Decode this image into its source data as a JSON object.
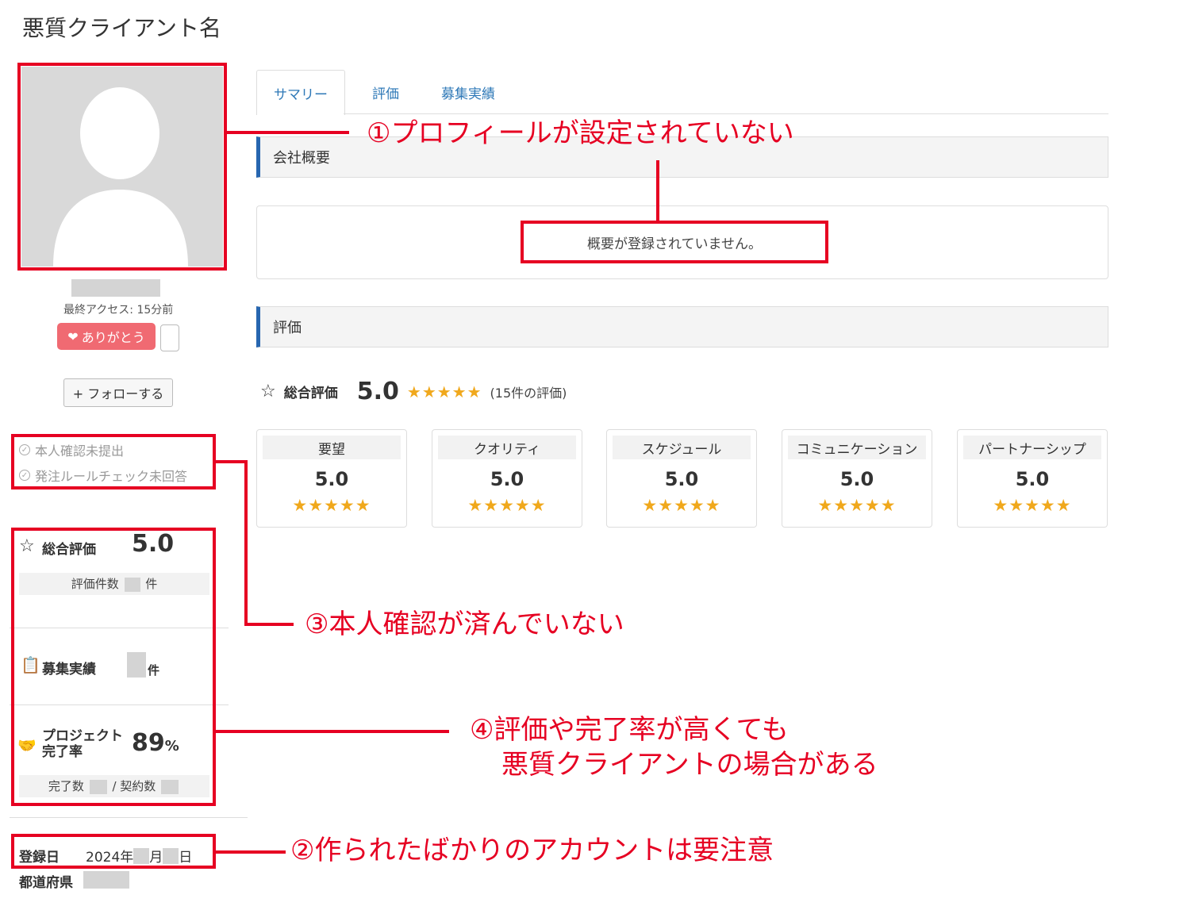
{
  "page": {
    "title": "悪質クライアント名"
  },
  "profile": {
    "last_access": "最終アクセス: 15分前",
    "thanks_label": "ありがとう",
    "follow_label": "+ フォローする",
    "checks": [
      "本人確認未提出",
      "発注ルールチェック未回答"
    ]
  },
  "side_stats": {
    "rating_label": "総合評価",
    "rating_value": "5.0",
    "review_count_prefix": "評価件数",
    "review_count_suffix": "件",
    "recruit_label": "募集実績",
    "recruit_suffix": "件",
    "project_label_line1": "プロジェクト",
    "project_label_line2": "完了率",
    "project_rate": "89",
    "project_rate_unit": "%",
    "completed_prefix": "完了数",
    "contracted_prefix": "/ 契約数",
    "registered_label": "登録日",
    "registered_year": "2024年",
    "registered_month": "月",
    "registered_day": "日",
    "prefecture_label": "都道府県"
  },
  "tabs": [
    "サマリー",
    "評価",
    "募集実績"
  ],
  "sections": {
    "company_title": "会社概要",
    "company_empty": "概要が登録されていません。",
    "rating_title": "評価"
  },
  "overall": {
    "label": "総合評価",
    "value": "5.0",
    "stars": "★★★★★",
    "count": "(15件の評価)"
  },
  "categories": [
    {
      "name": "要望",
      "score": "5.0",
      "stars": "★★★★★"
    },
    {
      "name": "クオリティ",
      "score": "5.0",
      "stars": "★★★★★"
    },
    {
      "name": "スケジュール",
      "score": "5.0",
      "stars": "★★★★★"
    },
    {
      "name": "コミュニケーション",
      "score": "5.0",
      "stars": "★★★★★"
    },
    {
      "name": "パートナーシップ",
      "score": "5.0",
      "stars": "★★★★★"
    }
  ],
  "annotations": {
    "note1": "①プロフィールが設定されていない",
    "note2": "②作られたばかりのアカウントは要注意",
    "note3": "③本人確認が済んでいない",
    "note4_line1": "④評価や完了率が高くても",
    "note4_line2": "悪質クライアントの場合がある"
  },
  "colors": {
    "annotation_red": "#e60022",
    "tab_blue": "#2e78b7",
    "section_accent": "#2766b0",
    "star": "#f0a81c",
    "thanks_pink": "#f06a72"
  }
}
